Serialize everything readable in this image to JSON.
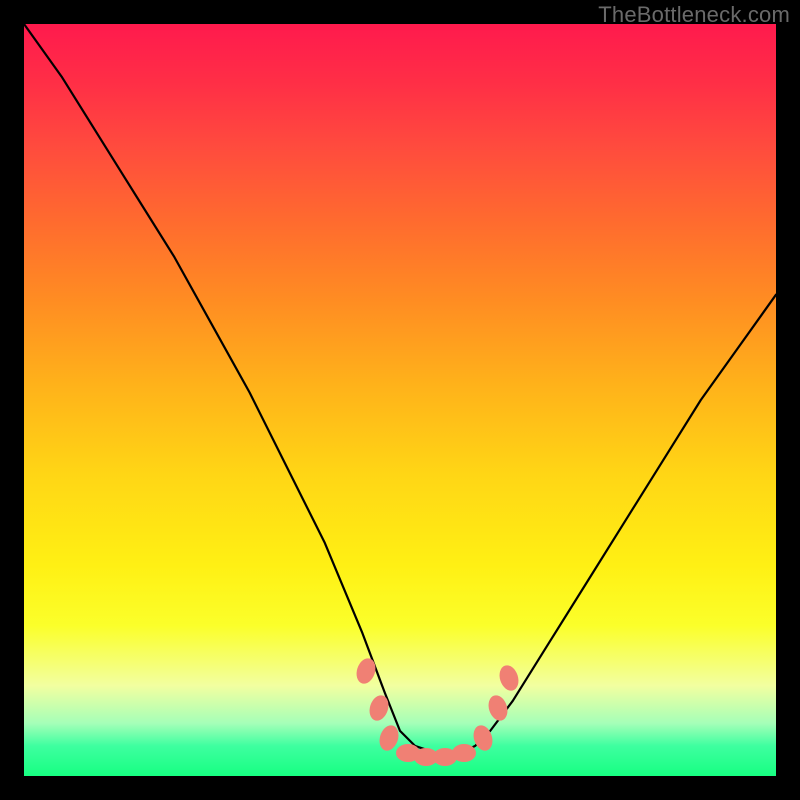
{
  "watermark": {
    "text": "TheBottleneck.com"
  },
  "chart_data": {
    "type": "line",
    "title": "",
    "xlabel": "",
    "ylabel": "",
    "xlim": [
      0,
      100
    ],
    "ylim": [
      0,
      100
    ],
    "grid": false,
    "legend": false,
    "series": [
      {
        "name": "bottleneck-curve",
        "x": [
          0,
          5,
          10,
          15,
          20,
          25,
          30,
          35,
          40,
          45,
          48,
          50,
          52,
          55,
          58,
          60,
          62,
          65,
          70,
          75,
          80,
          85,
          90,
          95,
          100
        ],
        "y": [
          100,
          93,
          85,
          77,
          69,
          60,
          51,
          41,
          31,
          19,
          11,
          6,
          4,
          3,
          3,
          4,
          6,
          10,
          18,
          26,
          34,
          42,
          50,
          57,
          64
        ]
      }
    ],
    "markers": [
      {
        "x": 45.5,
        "y": 14
      },
      {
        "x": 47.2,
        "y": 9
      },
      {
        "x": 48.6,
        "y": 5
      },
      {
        "x": 51.0,
        "y": 3
      },
      {
        "x": 53.5,
        "y": 2.5
      },
      {
        "x": 56.0,
        "y": 2.5
      },
      {
        "x": 58.5,
        "y": 3
      },
      {
        "x": 61.0,
        "y": 5
      },
      {
        "x": 63.0,
        "y": 9
      },
      {
        "x": 64.5,
        "y": 13
      }
    ],
    "background_gradient": {
      "stops": [
        {
          "pos": 0.0,
          "color": "#ff1a4d"
        },
        {
          "pos": 0.5,
          "color": "#ffd615"
        },
        {
          "pos": 0.8,
          "color": "#fbff2a"
        },
        {
          "pos": 1.0,
          "color": "#17ff82"
        }
      ]
    }
  }
}
